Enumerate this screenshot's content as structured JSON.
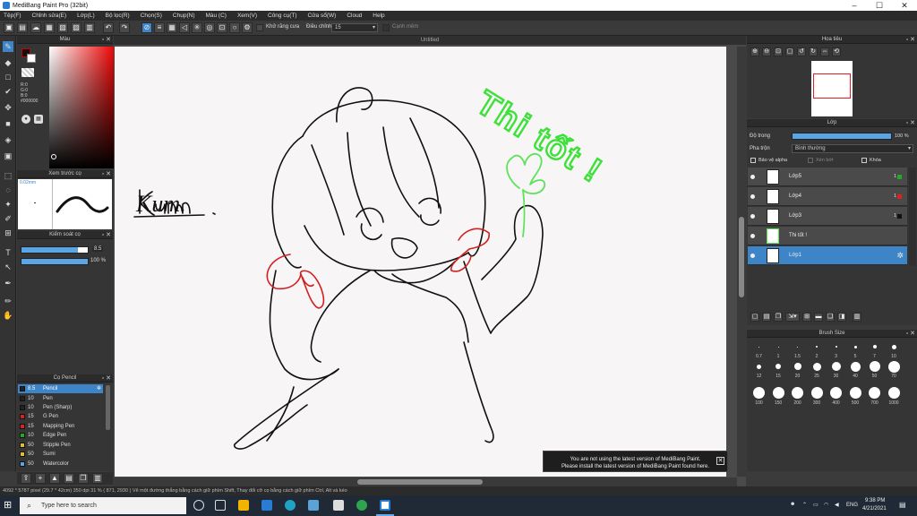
{
  "window": {
    "title": "MediBang Paint Pro (32bit)",
    "min": "–",
    "max": "☐",
    "close": "✕"
  },
  "menu": [
    "Tệp(F)",
    "Chỉnh sửa(E)",
    "Lớp(L)",
    "Bộ lọc(R)",
    "Chọn(S)",
    "Chụp(N)",
    "Màu (C)",
    "Xem(V)",
    "Công cụ(T)",
    "Cửa sổ(W)",
    "Cloud",
    "Help"
  ],
  "toolbar": {
    "antialias_label": "Khử răng cưa",
    "correction_label": "Điều chỉnh",
    "correction_value": "15",
    "canh_mem_label": "Cạnh mềm"
  },
  "color_panel": {
    "title": "Màu",
    "r": "R:0",
    "g": "G:0",
    "b": "B:0",
    "hex": "#000000"
  },
  "brush_preview": {
    "title": "Xem trước cọ",
    "size_label": "0.02mm"
  },
  "brush_control": {
    "title": "Kiểm soát cọ",
    "size_value": "8.5",
    "opacity_value": "100 %",
    "size_fraction": 0.85,
    "opacity_fraction": 1.0
  },
  "brush_list": {
    "title": "Cọ Pencil",
    "items": [
      {
        "size": "8.5",
        "name": "Pencil",
        "color": "#222222"
      },
      {
        "size": "10",
        "name": "Pen",
        "color": "#222222"
      },
      {
        "size": "10",
        "name": "Pen (Sharp)",
        "color": "#222222"
      },
      {
        "size": "15",
        "name": "G Pen",
        "color": "#e02020"
      },
      {
        "size": "15",
        "name": "Mapping Pen",
        "color": "#e02020"
      },
      {
        "size": "10",
        "name": "Edge Pen",
        "color": "#22aa22"
      },
      {
        "size": "50",
        "name": "Stipple Pen",
        "color": "#e0c020"
      },
      {
        "size": "50",
        "name": "Sumi",
        "color": "#e0c020"
      },
      {
        "size": "50",
        "name": "Watercolor",
        "color": "#5aa5e6"
      }
    ]
  },
  "canvas": {
    "tab": "Untitled",
    "signature_text": "Kum.",
    "green_text": "Thi tốt !"
  },
  "notice": {
    "line1": "You are not using the latest version of MediBang Paint.",
    "line2": "Please install the latest version of MediBang Paint found here.",
    "close": "✕"
  },
  "navigator": {
    "title": "Hoa tiêu"
  },
  "layers": {
    "title": "Lớp",
    "opacity_label": "Độ trong",
    "opacity_value": "100 %",
    "blend_label": "Pha trộn",
    "blend_value": "Bình thường",
    "protect_alpha": "Bảo vệ alpha",
    "clipping": "Xén bớt",
    "lock": "Khóa",
    "items": [
      {
        "name": "Lớp5",
        "num": "1",
        "dot": "#22aa22"
      },
      {
        "name": "Lớp4",
        "num": "1",
        "dot": "#e02020"
      },
      {
        "name": "Lớp3",
        "num": "1",
        "dot": "#111111"
      },
      {
        "name": "Thi tốt !",
        "num": "",
        "dot": ""
      },
      {
        "name": "Lớp1",
        "num": "",
        "dot": ""
      }
    ]
  },
  "brush_size": {
    "title": "Brush Size",
    "row1": [
      "0.7",
      "1",
      "1.5",
      "2",
      "3",
      "5",
      "7",
      "10"
    ],
    "row2": [
      "12",
      "15",
      "20",
      "25",
      "30",
      "40",
      "50",
      "70"
    ],
    "row3": [
      "100",
      "150",
      "200",
      "300",
      "400",
      "500",
      "700",
      "1000"
    ]
  },
  "status": "4092 * 5787 pixel  (29.7 * 42cm)  350 dpi  31 %  ( 871, 2930 )  Vẽ một đường thẳng bằng cách giữ phím Shift, Thay đổi cỡ cọ bằng cách giữ phím Ctrl, Alt và kéo",
  "taskbar": {
    "search_placeholder": "Type here to search",
    "time": "9:38 PM",
    "date": "4/21/2021",
    "lang": "ENG"
  }
}
